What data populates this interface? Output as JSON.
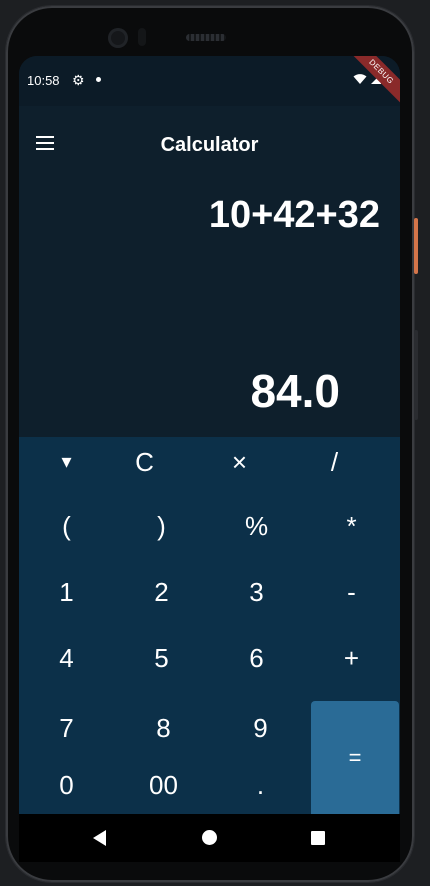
{
  "status_bar": {
    "time": "10:58",
    "icons": [
      "gear-icon",
      "notification-dot-icon",
      "wifi-icon",
      "signal-icon",
      "battery-icon"
    ],
    "debug_label": "DEBUG"
  },
  "app_bar": {
    "title": "Calculator",
    "menu_icon": "hamburger-menu-icon"
  },
  "display": {
    "expression": "10+42+32",
    "result": "84.0"
  },
  "keypad": {
    "rows": [
      [
        "▾",
        "C",
        "×",
        "/"
      ],
      [
        "(",
        ")",
        "%",
        "*"
      ],
      [
        "1",
        "2",
        "3",
        "-"
      ],
      [
        "4",
        "5",
        "6",
        "+"
      ],
      [
        "7",
        "8",
        "9"
      ],
      [
        "0",
        "00",
        "."
      ]
    ],
    "equals": "="
  },
  "nav_bar": {
    "icons": [
      "back-icon",
      "home-icon",
      "recents-icon"
    ]
  },
  "colors": {
    "display_bg": "#0e1f2c",
    "keypad_bg": "#0c3049",
    "equals_bg": "#2a6b96",
    "text": "#ffffff"
  }
}
